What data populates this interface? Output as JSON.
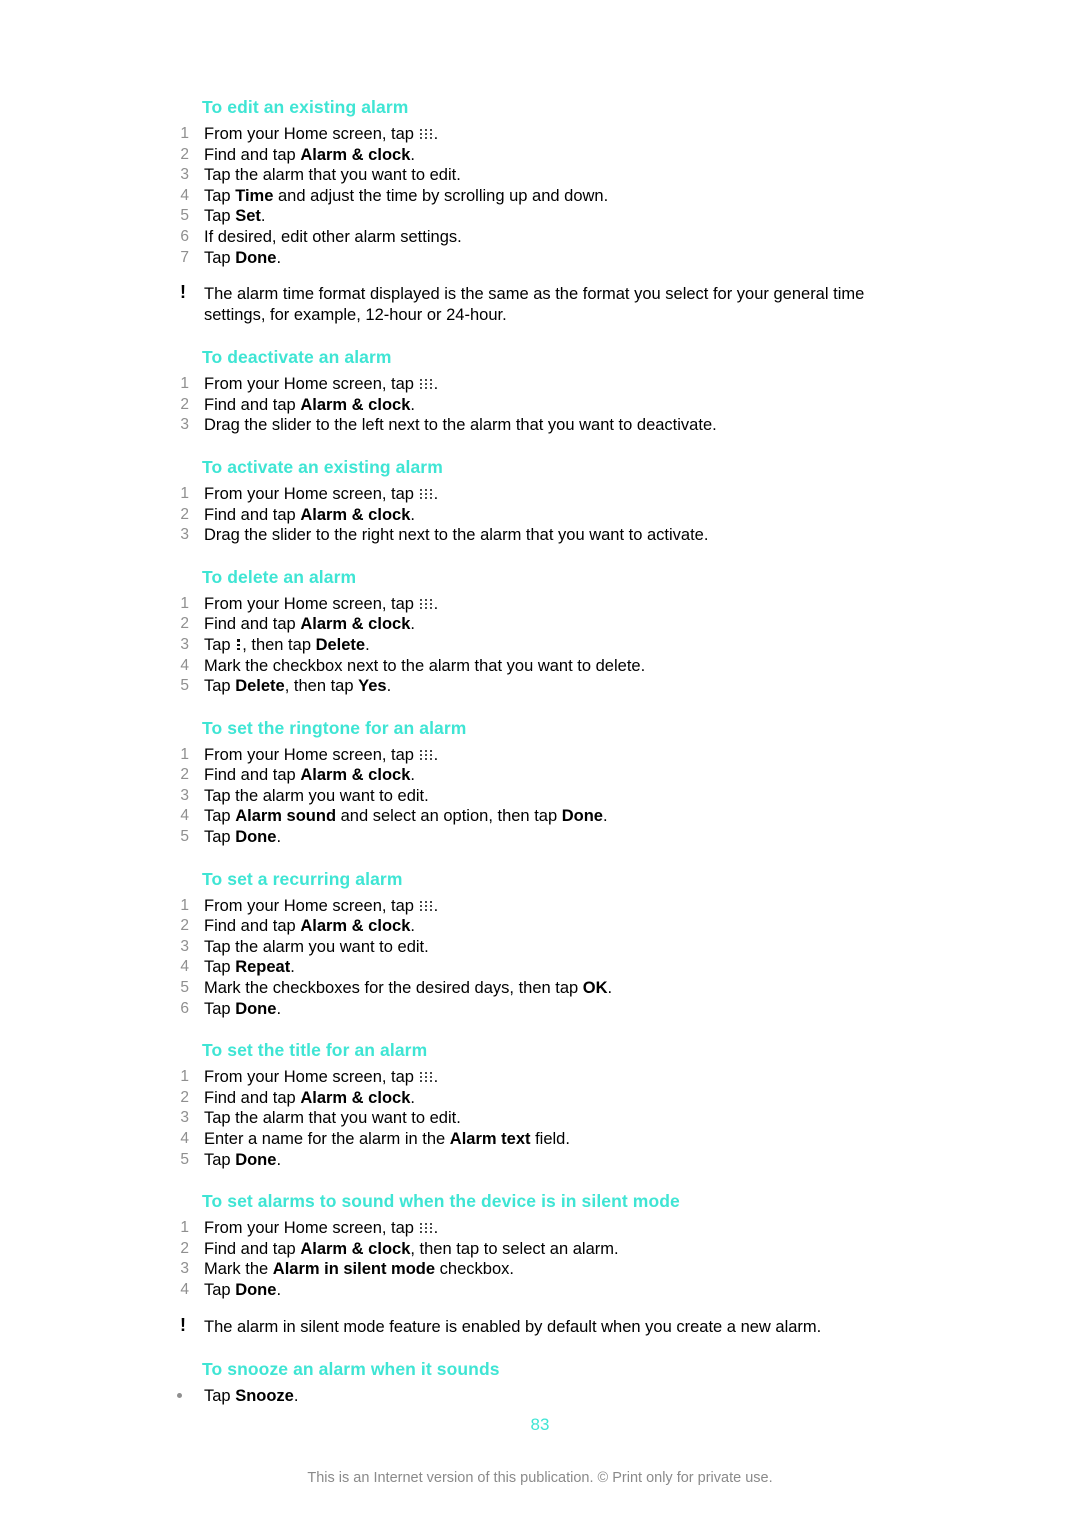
{
  "document": {
    "page_number": "83",
    "footer": "This is an Internet version of this publication. © Print only for private use.",
    "heading_color": "#3fe5d4",
    "number_color": "#8f8f8f"
  },
  "icons": {
    "app_grid": "app-grid-icon",
    "overflow_menu": "vertical-dots-icon",
    "note": "exclamation-icon",
    "bullet": "bullet-dot-icon"
  },
  "sections": [
    {
      "heading": "To edit an existing alarm",
      "steps": [
        {
          "n": "1",
          "pre": "From your Home screen, tap ",
          "icon": "app-grid",
          "post": "."
        },
        {
          "n": "2",
          "pre": "Find and tap ",
          "bold": "Alarm & clock",
          "post": "."
        },
        {
          "n": "3",
          "pre": "Tap the alarm that you want to edit."
        },
        {
          "n": "4",
          "pre": "Tap ",
          "bold": "Time",
          "post": " and adjust the time by scrolling up and down."
        },
        {
          "n": "5",
          "pre": "Tap ",
          "bold": "Set",
          "post": "."
        },
        {
          "n": "6",
          "pre": "If desired, edit other alarm settings."
        },
        {
          "n": "7",
          "pre": "Tap ",
          "bold": "Done",
          "post": "."
        }
      ],
      "note": "The alarm time format displayed is the same as the format you select for your general time settings, for example, 12-hour or 24-hour."
    },
    {
      "heading": "To deactivate an alarm",
      "steps": [
        {
          "n": "1",
          "pre": "From your Home screen, tap ",
          "icon": "app-grid",
          "post": "."
        },
        {
          "n": "2",
          "pre": "Find and tap ",
          "bold": "Alarm & clock",
          "post": "."
        },
        {
          "n": "3",
          "pre": "Drag the slider to the left next to the alarm that you want to deactivate."
        }
      ]
    },
    {
      "heading": "To activate an existing alarm",
      "steps": [
        {
          "n": "1",
          "pre": "From your Home screen, tap ",
          "icon": "app-grid",
          "post": "."
        },
        {
          "n": "2",
          "pre": "Find and tap ",
          "bold": "Alarm & clock",
          "post": "."
        },
        {
          "n": "3",
          "pre": "Drag the slider to the right next to the alarm that you want to activate."
        }
      ]
    },
    {
      "heading": "To delete an alarm",
      "steps": [
        {
          "n": "1",
          "pre": "From your Home screen, tap ",
          "icon": "app-grid",
          "post": "."
        },
        {
          "n": "2",
          "pre": "Find and tap ",
          "bold": "Alarm & clock",
          "post": "."
        },
        {
          "n": "3",
          "pre": "Tap ",
          "icon": "overflow",
          "post": ", then tap ",
          "bold2": "Delete",
          "post2": "."
        },
        {
          "n": "4",
          "pre": "Mark the checkbox next to the alarm that you want to delete."
        },
        {
          "n": "5",
          "pre": "Tap ",
          "bold": "Delete",
          "post": ", then tap ",
          "bold2": "Yes",
          "post2": "."
        }
      ]
    },
    {
      "heading": "To set the ringtone for an alarm",
      "steps": [
        {
          "n": "1",
          "pre": "From your Home screen, tap ",
          "icon": "app-grid",
          "post": "."
        },
        {
          "n": "2",
          "pre": "Find and tap ",
          "bold": "Alarm & clock",
          "post": "."
        },
        {
          "n": "3",
          "pre": "Tap the alarm you want to edit."
        },
        {
          "n": "4",
          "pre": "Tap ",
          "bold": "Alarm sound",
          "post": " and select an option, then tap ",
          "bold2": "Done",
          "post2": "."
        },
        {
          "n": "5",
          "pre": "Tap ",
          "bold": "Done",
          "post": "."
        }
      ]
    },
    {
      "heading": "To set a recurring alarm",
      "steps": [
        {
          "n": "1",
          "pre": "From your Home screen, tap ",
          "icon": "app-grid",
          "post": "."
        },
        {
          "n": "2",
          "pre": "Find and tap ",
          "bold": "Alarm & clock",
          "post": "."
        },
        {
          "n": "3",
          "pre": "Tap the alarm you want to edit."
        },
        {
          "n": "4",
          "pre": "Tap ",
          "bold": "Repeat",
          "post": "."
        },
        {
          "n": "5",
          "pre": "Mark the checkboxes for the desired days, then tap ",
          "bold": "OK",
          "post": "."
        },
        {
          "n": "6",
          "pre": "Tap ",
          "bold": "Done",
          "post": "."
        }
      ]
    },
    {
      "heading": "To set the title for an alarm",
      "steps": [
        {
          "n": "1",
          "pre": "From your Home screen, tap ",
          "icon": "app-grid",
          "post": "."
        },
        {
          "n": "2",
          "pre": "Find and tap ",
          "bold": "Alarm & clock",
          "post": "."
        },
        {
          "n": "3",
          "pre": "Tap the alarm that you want to edit."
        },
        {
          "n": "4",
          "pre": "Enter a name for the alarm in the ",
          "bold": "Alarm text",
          "post": " field."
        },
        {
          "n": "5",
          "pre": "Tap ",
          "bold": "Done",
          "post": "."
        }
      ]
    },
    {
      "heading": "To set alarms to sound when the device is in silent mode",
      "steps": [
        {
          "n": "1",
          "pre": "From your Home screen, tap ",
          "icon": "app-grid",
          "post": "."
        },
        {
          "n": "2",
          "pre": "Find and tap ",
          "bold": "Alarm & clock",
          "post": ", then tap to select an alarm."
        },
        {
          "n": "3",
          "pre": "Mark the ",
          "bold": "Alarm in silent mode",
          "post": " checkbox."
        },
        {
          "n": "4",
          "pre": "Tap ",
          "bold": "Done",
          "post": "."
        }
      ],
      "note": "The alarm in silent mode feature is enabled by default when you create a new alarm."
    },
    {
      "heading": "To snooze an alarm when it sounds",
      "bullets": [
        {
          "pre": "Tap ",
          "bold": "Snooze",
          "post": "."
        }
      ]
    }
  ]
}
